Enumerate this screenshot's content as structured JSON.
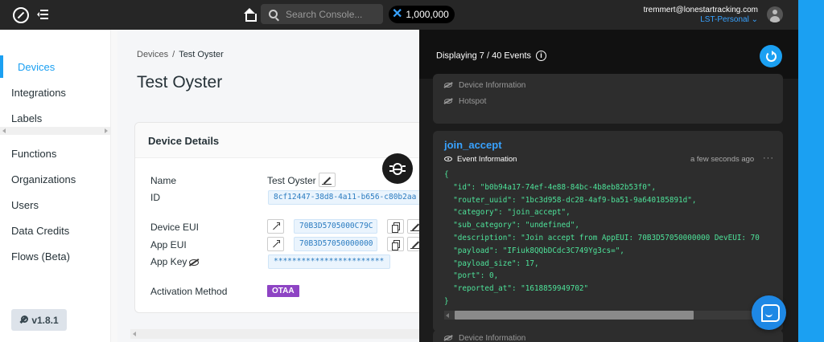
{
  "topbar": {
    "search_placeholder": "Search Console...",
    "data_credits": "1,000,000",
    "user_email": "tremmert@lonestartracking.com",
    "org_name": "LST-Personal",
    "org_chevron": "⌄"
  },
  "sidebar": {
    "items": [
      {
        "label": "Devices",
        "active": true
      },
      {
        "label": "Integrations"
      },
      {
        "label": "Labels"
      },
      {
        "label": "Functions"
      },
      {
        "label": "Organizations"
      },
      {
        "label": "Users"
      },
      {
        "label": "Data Credits"
      },
      {
        "label": "Flows (Beta)"
      }
    ],
    "version": "v1.8.1"
  },
  "breadcrumb": {
    "root": "Devices",
    "sep": "/",
    "current": "Test Oyster"
  },
  "page": {
    "title": "Test Oyster"
  },
  "device_details": {
    "header": "Device Details",
    "name_label": "Name",
    "name_value": "Test Oyster",
    "id_label": "ID",
    "id_value": "8cf12447-38d8-4a11-b656-c80b2aa",
    "dev_eui_label": "Device EUI",
    "dev_eui_value": "70B3D5705000C79C",
    "app_eui_label": "App EUI",
    "app_eui_value": "70B3D57050000000",
    "app_key_label": "App Key",
    "app_key_value": "************************",
    "activation_label": "Activation Method",
    "activation_value": "OTAA"
  },
  "debug": {
    "count_text": "Displaying 7 / 40 Events",
    "info_glyph": "i",
    "prev_event": {
      "device_info": "Device Information",
      "hotspot": "Hotspot"
    },
    "event": {
      "title": "join_accept",
      "info_label": "Event Information",
      "time": "a few seconds ago",
      "more": "···",
      "json": "{\n  \"id\": \"b0b94a17-74ef-4e88-84bc-4b8eb82b53f0\",\n  \"router_uuid\": \"1bc3d958-dc28-4af9-ba51-9a640185891d\",\n  \"category\": \"join_accept\",\n  \"sub_category\": \"undefined\",\n  \"description\": \"Join accept from AppEUI: 70B3D57050000000 DevEUI: 70\n  \"payload\": \"IFiuk8QQbDCdc3C749Yg3cs=\",\n  \"payload_size\": 17,\n  \"port\": 0,\n  \"reported_at\": \"1618859949702\"\n}"
    },
    "next_event": {
      "device_info": "Device Information"
    }
  }
}
